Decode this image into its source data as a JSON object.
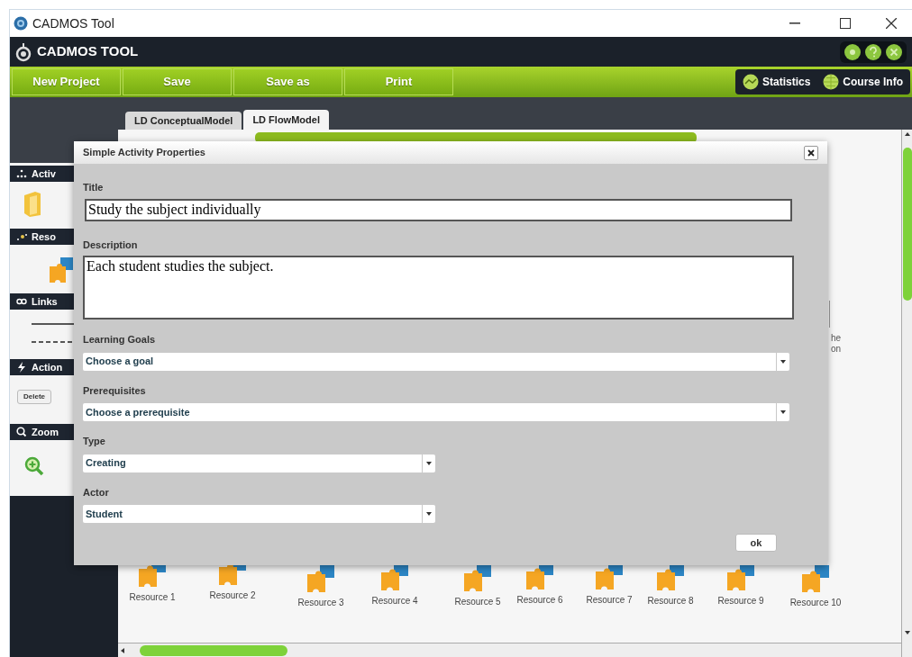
{
  "window": {
    "title": "CADMOS Tool"
  },
  "app_header": {
    "title": "CADMOS TOOL"
  },
  "toolbar": {
    "buttons": [
      "New Project",
      "Save",
      "Save as",
      "Print"
    ],
    "right_buttons": [
      {
        "label": "Statistics",
        "kind": "statistics"
      },
      {
        "label": "Course Info",
        "kind": "info"
      }
    ]
  },
  "tabs": [
    {
      "label": "LD ConceptualModel",
      "selected": false
    },
    {
      "label": "LD FlowModel",
      "selected": true
    }
  ],
  "sidebar": {
    "sections": [
      {
        "title": "Activ",
        "kind": "activities"
      },
      {
        "title": "Reso",
        "kind": "resources"
      },
      {
        "title": "Links",
        "kind": "links"
      },
      {
        "title": "Action",
        "kind": "actions",
        "button": "Delete"
      },
      {
        "title": "Zoom",
        "kind": "zoom"
      }
    ]
  },
  "canvas": {
    "resources": [
      "Resource 1",
      "Resource 2",
      "Resource 3",
      "Resource 4",
      "Resource 5",
      "Resource 6",
      "Resource 7",
      "Resource 8",
      "Resource 9",
      "Resource 10"
    ],
    "text_fragments": [
      "he",
      "on"
    ]
  },
  "dialog": {
    "title": "Simple Activity Properties",
    "fields": [
      {
        "label": "Title",
        "kind": "text",
        "value": "Study the subject individually"
      },
      {
        "label": "Description",
        "kind": "textarea",
        "value": "Each student studies the subject."
      },
      {
        "label": "Learning Goals",
        "kind": "select-wide",
        "value": "Choose a goal"
      },
      {
        "label": "Prerequisites",
        "kind": "select-wide",
        "value": "Choose a prerequisite"
      },
      {
        "label": "Type",
        "kind": "select",
        "value": "Creating"
      },
      {
        "label": "Actor",
        "kind": "select",
        "value": "Student"
      }
    ],
    "ok_button": "ok"
  }
}
